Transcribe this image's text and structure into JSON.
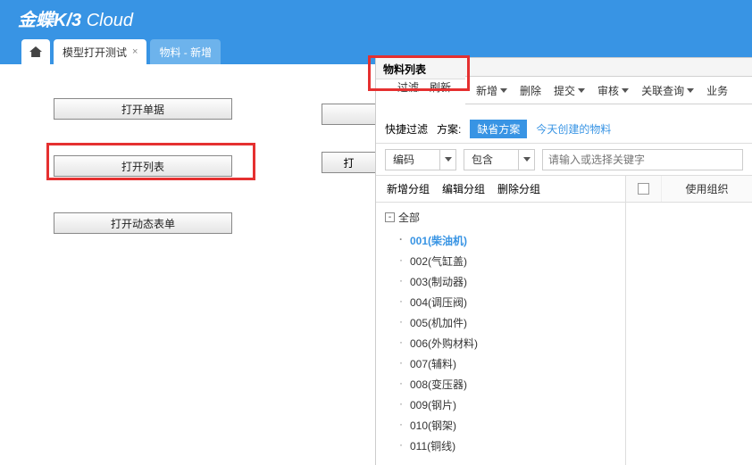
{
  "logo": {
    "brand": "金蝶K/3",
    "suffix": "Cloud"
  },
  "tabs": {
    "active": "模型打开测试",
    "close": "×",
    "inactive": "物料 - 新增"
  },
  "leftButtons": {
    "b1": "打开单据",
    "b2": "打开列表",
    "b3": "打开动态表单",
    "partial": "打"
  },
  "popup": {
    "title": "物料列表",
    "sub1": "过滤",
    "sub2": "刷新",
    "toolbar": {
      "t1": "新增",
      "t2": "删除",
      "t3": "提交",
      "t4": "审核",
      "t5": "关联查询",
      "t6": "业务"
    },
    "filter": {
      "quick": "快捷过滤",
      "schemeLbl": "方案:",
      "schemeDef": "缺省方案",
      "schemeLnk": "今天创建的物料"
    },
    "search": {
      "field": "编码",
      "op": "包含",
      "placeholder": "请输入或选择关键字"
    },
    "treeHd": {
      "a": "新增分组",
      "b": "编辑分组",
      "c": "删除分组"
    },
    "treeRoot": "全部",
    "treeItems": [
      "001(柴油机)",
      "002(气缸盖)",
      "003(制动器)",
      "004(调压阀)",
      "005(机加件)",
      "006(外购材料)",
      "007(辅料)",
      "008(变压器)",
      "009(钢片)",
      "010(钢架)",
      "011(铜线)"
    ],
    "gridCol": "使用组织"
  }
}
